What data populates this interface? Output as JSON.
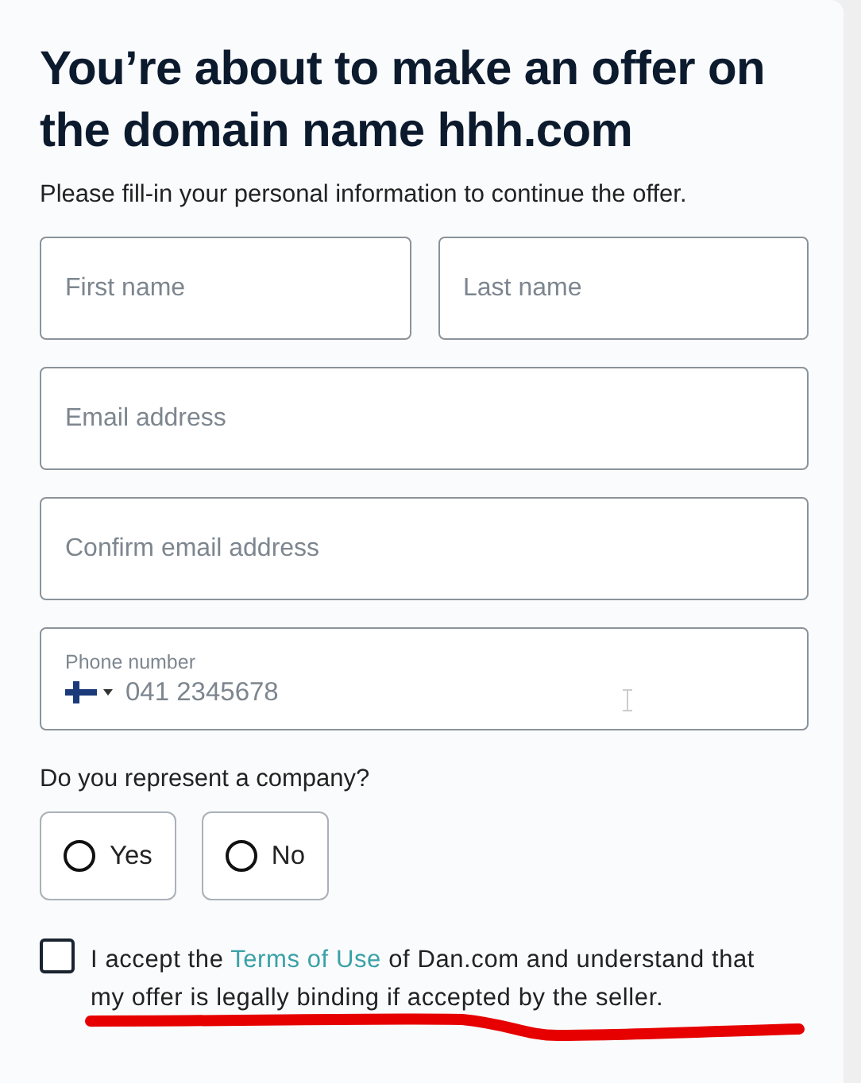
{
  "heading": "You’re about to make an offer on the domain name hhh.com",
  "subtitle": "Please fill-in your personal information to continue the offer.",
  "field_rows": [
    [
      {
        "kind": "text",
        "placeholder": "First name"
      },
      {
        "kind": "text",
        "placeholder": "Last name"
      }
    ],
    [
      {
        "kind": "text",
        "placeholder": "Email address"
      }
    ],
    [
      {
        "kind": "text",
        "placeholder": "Confirm email address"
      }
    ],
    [
      {
        "kind": "phone",
        "label": "Phone number",
        "placeholder": "041 2345678"
      }
    ]
  ],
  "company_question": "Do you represent a company?",
  "company_options": [
    {
      "label": "Yes",
      "selected": false
    },
    {
      "label": "No",
      "selected": false
    }
  ],
  "consent": {
    "checked": false,
    "text_before": "I accept the",
    "link": "Terms of Use",
    "text_after": "of Dan.com and understand that my offer is legally binding if accepted by the seller."
  }
}
